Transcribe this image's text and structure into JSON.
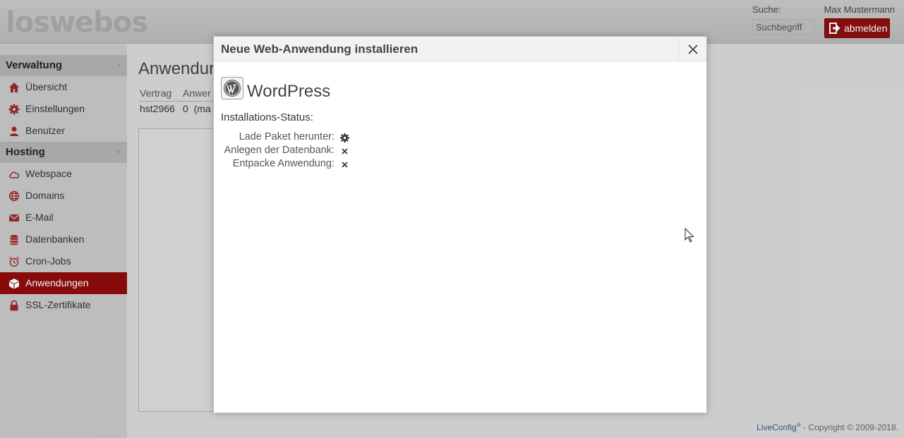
{
  "header": {
    "logo": "loswebos",
    "search_label": "Suche:",
    "search_placeholder": "Suchbegriff",
    "user_name": "Max Mustermann",
    "logout_label": "abmelden"
  },
  "sidebar": {
    "sections": [
      {
        "title": "Verwaltung",
        "items": [
          {
            "label": "Übersicht",
            "icon": "home-icon"
          },
          {
            "label": "Einstellungen",
            "icon": "gear-icon"
          },
          {
            "label": "Benutzer",
            "icon": "user-icon"
          }
        ]
      },
      {
        "title": "Hosting",
        "items": [
          {
            "label": "Webspace",
            "icon": "cloud-icon"
          },
          {
            "label": "Domains",
            "icon": "globe-icon"
          },
          {
            "label": "E-Mail",
            "icon": "envelope-icon"
          },
          {
            "label": "Datenbanken",
            "icon": "database-icon"
          },
          {
            "label": "Cron-Jobs",
            "icon": "alarm-clock-icon"
          },
          {
            "label": "Anwendungen",
            "icon": "cube-icon",
            "active": true
          },
          {
            "label": "SSL-Zertifikate",
            "icon": "lock-icon"
          }
        ]
      }
    ]
  },
  "main": {
    "page_title": "Anwendur",
    "columns": [
      {
        "header": "Vertrag",
        "value": "hst2966"
      },
      {
        "header": "Anwer",
        "value": "0  (ma"
      }
    ]
  },
  "dialog": {
    "title": "Neue Web-Anwendung installieren",
    "app_name": "WordPress",
    "app_icon": "wordpress-icon",
    "status_label": "Installations-Status:",
    "steps": [
      {
        "label": "Lade Paket herunter:",
        "state": "in-progress",
        "icon": "gear-icon"
      },
      {
        "label": "Anlegen der Datenbank:",
        "state": "pending",
        "icon": "close-icon"
      },
      {
        "label": "Entpacke Anwendung:",
        "state": "pending",
        "icon": "close-icon"
      }
    ]
  },
  "footer": {
    "brand": "LiveConfig",
    "reg": "®",
    "copyright": " - Copyright © 2009-2018."
  },
  "colors": {
    "accent": "#900c0c",
    "sidebar_bg": "#c8c8c8",
    "section_bg": "#b2b2b2"
  }
}
